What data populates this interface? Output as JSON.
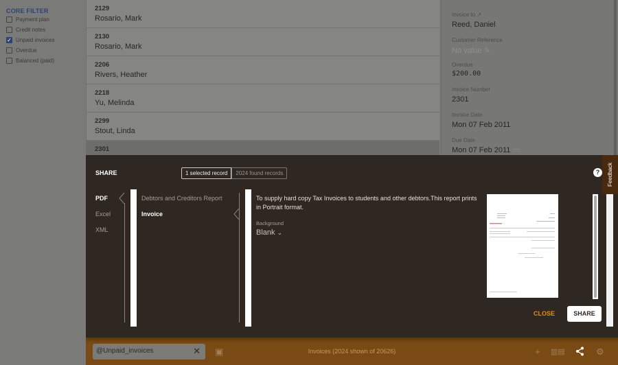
{
  "sidebar": {
    "title": "CORE FILTER",
    "filters": [
      {
        "label": "Payment plan",
        "checked": false
      },
      {
        "label": "Credit notes",
        "checked": false
      },
      {
        "label": "Unpaid invoices",
        "checked": true
      },
      {
        "label": "Overdue",
        "checked": false
      },
      {
        "label": "Balanced (paid)",
        "checked": false
      }
    ]
  },
  "list": {
    "rows": [
      {
        "number": "2129",
        "name": "Rosario, Mark"
      },
      {
        "number": "2130",
        "name": "Rosario, Mark"
      },
      {
        "number": "2206",
        "name": "Rivers, Heather"
      },
      {
        "number": "2218",
        "name": "Yu, Melinda"
      },
      {
        "number": "2299",
        "name": "Stout, Linda"
      },
      {
        "number": "2301",
        "name": ""
      }
    ]
  },
  "detail": {
    "invoice_to_label": "Invoice to",
    "invoice_to": "Reed, Daniel",
    "customer_ref_label": "Customer Reference",
    "customer_ref": "No value",
    "overdue_label": "Overdue",
    "overdue": "$200.00",
    "invoice_number_label": "Invoice Number",
    "invoice_number": "2301",
    "invoice_date_label": "Invoice Date",
    "invoice_date": "Mon 07 Feb 2011",
    "due_date_label": "Due Date",
    "due_date": "Mon 07 Feb 2011"
  },
  "share": {
    "title": "SHARE",
    "selected_scope": "1 selected record",
    "found_scope": "2024 found records",
    "formats": [
      "PDF",
      "Excel",
      "XML"
    ],
    "reports": [
      "Debtors and Creditors Report",
      "Invoice"
    ],
    "description": "To supply hard copy Tax Invoices to students and other debtors.This report prints in Portrait format.",
    "background_label": "Background",
    "background_value": "Blank",
    "close_label": "CLOSE",
    "share_label": "SHARE",
    "help": "?"
  },
  "feedback": "Feedback",
  "bottom": {
    "search_value": "@Unpaid_invoices",
    "status": "Invoices (2024 shown of 20626)"
  },
  "colors": {
    "accent": "#e8891a",
    "bottom_bar": "#7a4a14",
    "modal": "#2f2822"
  }
}
